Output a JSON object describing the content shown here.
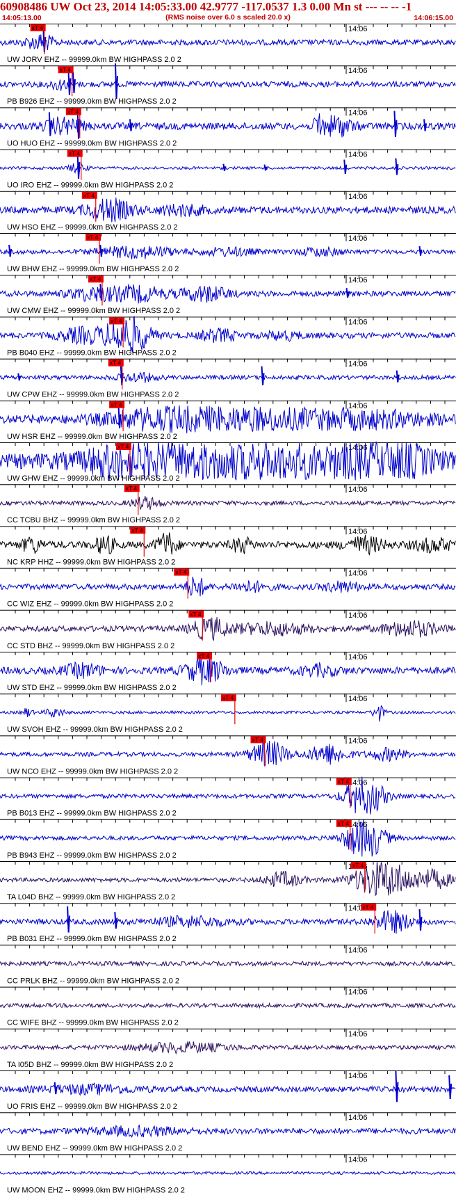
{
  "header": {
    "title": "60908486 UW Oct 23, 2014 14:05:33.00   42.9777 -117.0537  1.3 0.00 Mn st --- -- --  -1",
    "subtitle": "(RMS noise over 6.0 s scaled 20.0 x)",
    "time_start": "14:05:13.00",
    "time_end": "14:06:15.00"
  },
  "chart_data": {
    "type": "line",
    "title": "60908486 UW Oct 23, 2014 14:05:33.00   42.9777 -117.0537  1.3 0.00 Mn st --- -- --  -1",
    "subtitle": "(RMS noise over 6.0 s scaled 20.0 x)",
    "x_range": [
      "14:05:13.00",
      "14:06:15.00"
    ],
    "x_tick_label": "14:06",
    "pick_label": "xT 4",
    "grid": false,
    "traces": [
      {
        "label": "UW JORV EHZ -- 99999.0km BW  HIGHPASS  2.0  2",
        "color": "#0000cc",
        "amp": 4,
        "pick": 0.097,
        "bursts": [
          [
            0.08,
            0.03,
            7
          ],
          [
            0.1,
            0.02,
            5
          ]
        ],
        "spikes": [
          [
            0.095,
            20
          ]
        ]
      },
      {
        "label": "PB B926 EHZ -- 99999.0km BW  HIGHPASS  2.0  2",
        "color": "#0000cc",
        "amp": 4,
        "pick": 0.158,
        "bursts": [
          [
            0.13,
            0.02,
            6
          ]
        ],
        "spikes": [
          [
            0.15,
            22
          ],
          [
            0.253,
            30
          ],
          [
            0.16,
            18
          ]
        ]
      },
      {
        "label": "UO HUO EHZ -- 99999.0km BW  HIGHPASS  2.0  2",
        "color": "#0000cc",
        "amp": 5,
        "pick": 0.175,
        "bursts": [
          [
            0.14,
            0.04,
            10
          ],
          [
            0.74,
            0.03,
            14
          ],
          [
            0.7,
            0.01,
            18
          ]
        ],
        "spikes": [
          [
            0.108,
            20
          ],
          [
            0.17,
            26
          ],
          [
            0.865,
            22
          ],
          [
            0.93,
            10
          ],
          [
            0.285,
            10
          ]
        ]
      },
      {
        "label": "UO IRO EHZ -- 99999.0km BW  HIGHPASS  2.0  2",
        "color": "#0000cc",
        "amp": 2,
        "pick": 0.178,
        "bursts": [
          [
            0.17,
            0.02,
            6
          ]
        ],
        "spikes": [
          [
            0.17,
            22
          ],
          [
            0.755,
            12
          ],
          [
            0.868,
            14
          ],
          [
            0.49,
            6
          ],
          [
            0.58,
            5
          ]
        ]
      },
      {
        "label": "UW HSO EHZ -- 99999.0km BW  HIGHPASS  2.0  2",
        "color": "#0000cc",
        "amp": 5,
        "pick": 0.21,
        "bursts": [
          [
            0.24,
            0.05,
            14
          ],
          [
            0.4,
            0.05,
            6
          ]
        ],
        "spikes": []
      },
      {
        "label": "UW BHW EHZ -- 99999.0km BW  HIGHPASS  2.0  2",
        "color": "#0000cc",
        "amp": 3,
        "pick": 0.218,
        "bursts": [
          [
            0.3,
            0.08,
            8
          ],
          [
            0.5,
            0.06,
            5
          ],
          [
            0.7,
            0.05,
            5
          ]
        ],
        "spikes": [
          [
            0.02,
            10
          ],
          [
            0.92,
            8
          ],
          [
            0.22,
            10
          ]
        ]
      },
      {
        "label": "UW CMW EHZ -- 99999.0km BW  HIGHPASS  2.0  2",
        "color": "#0000cc",
        "amp": 4,
        "pick": 0.224,
        "bursts": [
          [
            0.3,
            0.06,
            10
          ],
          [
            0.45,
            0.05,
            10
          ],
          [
            0.2,
            0.05,
            8
          ]
        ],
        "spikes": [
          [
            0.22,
            14
          ],
          [
            0.76,
            8
          ]
        ]
      },
      {
        "label": "PB B040 EHZ -- 99999.0km BW  HIGHPASS  2.0  2",
        "color": "#0000cc",
        "amp": 4,
        "pick": 0.27,
        "bursts": [
          [
            0.28,
            0.045,
            30
          ],
          [
            0.18,
            0.05,
            10
          ],
          [
            0.48,
            0.04,
            8
          ],
          [
            0.62,
            0.04,
            5
          ]
        ],
        "spikes": []
      },
      {
        "label": "UW CPW EHZ -- 99999.0km BW  HIGHPASS  2.0  2",
        "color": "#0000cc",
        "amp": 3,
        "pick": 0.268,
        "bursts": [
          [
            0.3,
            0.04,
            6
          ]
        ],
        "spikes": [
          [
            0.265,
            16
          ],
          [
            0.574,
            16
          ],
          [
            0.87,
            10
          ],
          [
            0.04,
            6
          ]
        ]
      },
      {
        "label": "UW HSR EHZ -- 99999.0km BW  HIGHPASS  2.0  2",
        "color": "#0000cc",
        "amp": 6,
        "pick": 0.27,
        "bursts": [
          [
            0.35,
            0.12,
            12
          ],
          [
            0.55,
            0.15,
            12
          ],
          [
            0.8,
            0.15,
            10
          ]
        ],
        "spikes": [
          [
            0.26,
            18
          ]
        ]
      },
      {
        "label": "UW GHW EHZ -- 99999.0km BW  HIGHPASS  2.0  2",
        "color": "#0000cc",
        "amp": 10,
        "pick": 0.285,
        "bursts": [
          [
            0.5,
            0.25,
            26
          ],
          [
            0.85,
            0.1,
            22
          ],
          [
            0.25,
            0.05,
            12
          ]
        ],
        "spikes": []
      },
      {
        "label": "CC TCBU BHZ -- 99999.0km BW  HIGHPASS  2.0  2",
        "color": "#2a1060",
        "amp": 3,
        "pick": 0.303,
        "bursts": [
          [
            0.32,
            0.03,
            8
          ]
        ],
        "spikes": []
      },
      {
        "label": "NC KRP HHZ -- 99999.0km BW  HIGHPASS  2.0  2",
        "color": "#000000",
        "amp": 5,
        "pick": 0.316,
        "bursts": [
          [
            0.07,
            0.02,
            10
          ],
          [
            0.23,
            0.02,
            12
          ],
          [
            0.365,
            0.02,
            16
          ],
          [
            0.53,
            0.02,
            10
          ],
          [
            0.8,
            0.04,
            10
          ],
          [
            0.95,
            0.04,
            8
          ]
        ],
        "spikes": []
      },
      {
        "label": "CC WIZ EHZ -- 99999.0km BW  HIGHPASS  2.0  2",
        "color": "#0000cc",
        "amp": 4,
        "pick": 0.412,
        "bursts": [
          [
            0.43,
            0.02,
            14
          ],
          [
            0.55,
            0.04,
            6
          ],
          [
            0.75,
            0.04,
            6
          ]
        ],
        "spikes": []
      },
      {
        "label": "CC STD BHZ -- 99999.0km BW  HIGHPASS  2.0  2",
        "color": "#2a1060",
        "amp": 4,
        "pick": 0.444,
        "bursts": [
          [
            0.46,
            0.04,
            14
          ],
          [
            0.6,
            0.08,
            8
          ],
          [
            0.9,
            0.06,
            10
          ]
        ],
        "spikes": []
      },
      {
        "label": "UW STD EHZ -- 99999.0km BW  HIGHPASS  2.0  2",
        "color": "#0000cc",
        "amp": 5,
        "pick": 0.462,
        "bursts": [
          [
            0.45,
            0.04,
            18
          ],
          [
            0.18,
            0.04,
            8
          ],
          [
            0.7,
            0.04,
            6
          ]
        ],
        "spikes": []
      },
      {
        "label": "UW SVOH EHZ -- 99999.0km BW  HIGHPASS  2.0  2",
        "color": "#0000cc",
        "amp": 2,
        "pick": 0.515,
        "bursts": [
          [
            0.83,
            0.012,
            12
          ],
          [
            0.12,
            0.02,
            6
          ],
          [
            0.06,
            0.01,
            6
          ]
        ],
        "spikes": []
      },
      {
        "label": "UW NCO EHZ -- 99999.0km BW  HIGHPASS  2.0  2",
        "color": "#0000cc",
        "amp": 3,
        "pick": 0.58,
        "bursts": [
          [
            0.59,
            0.04,
            18
          ],
          [
            0.72,
            0.04,
            14
          ],
          [
            0.85,
            0.04,
            8
          ]
        ],
        "spikes": []
      },
      {
        "label": "PB B013 EHZ -- 99999.0km BW  HIGHPASS  2.0  2",
        "color": "#0000cc",
        "amp": 3,
        "pick": 0.768,
        "bursts": [
          [
            0.8,
            0.04,
            30
          ]
        ],
        "spikes": []
      },
      {
        "label": "PB B943 EHZ -- 99999.0km BW  HIGHPASS  2.0  2",
        "color": "#0000cc",
        "amp": 3,
        "pick": 0.768,
        "bursts": [
          [
            0.8,
            0.04,
            32
          ]
        ],
        "spikes": []
      },
      {
        "label": "TA L04D BHZ -- 99999.0km BW  HIGHPASS  2.0  2",
        "color": "#2a1060",
        "amp": 3,
        "pick": 0.8,
        "bursts": [
          [
            0.62,
            0.04,
            10
          ],
          [
            0.84,
            0.06,
            28
          ],
          [
            0.95,
            0.04,
            12
          ]
        ],
        "spikes": []
      },
      {
        "label": "PB B031 EHZ -- 99999.0km BW  HIGHPASS  2.0  2",
        "color": "#0000cc",
        "amp": 4,
        "pick": 0.822,
        "bursts": [
          [
            0.42,
            0.08,
            6
          ],
          [
            0.86,
            0.04,
            14
          ]
        ],
        "spikes": [
          [
            0.148,
            22
          ],
          [
            0.252,
            14
          ],
          [
            0.92,
            18
          ]
        ]
      },
      {
        "label": "CC PRLK BHZ -- 99999.0km BW  HIGHPASS  2.0  2",
        "color": "#2a1060",
        "amp": 3,
        "pick": null,
        "bursts": [],
        "spikes": []
      },
      {
        "label": "CC WIFE BHZ -- 99999.0km BW  HIGHPASS  2.0  2",
        "color": "#2a1060",
        "amp": 3,
        "pick": null,
        "bursts": [],
        "spikes": []
      },
      {
        "label": "TA I05D BHZ -- 99999.0km BW  HIGHPASS  2.0  2",
        "color": "#2a1060",
        "amp": 3,
        "pick": null,
        "bursts": [
          [
            0.4,
            0.1,
            6
          ]
        ],
        "spikes": []
      },
      {
        "label": "UO FRIS EHZ -- 99999.0km BW  HIGHPASS  2.0  2",
        "color": "#0000cc",
        "amp": 4,
        "pick": null,
        "bursts": [
          [
            0.2,
            0.1,
            5
          ]
        ],
        "spikes": [
          [
            0.868,
            26
          ],
          [
            0.985,
            20
          ],
          [
            0.12,
            10
          ]
        ]
      },
      {
        "label": "UW BEND EHZ -- 99999.0km BW  HIGHPASS  2.0  2",
        "color": "#0000cc",
        "amp": 4,
        "pick": null,
        "bursts": [
          [
            0.3,
            0.1,
            5
          ]
        ],
        "spikes": []
      },
      {
        "label": "UW MOON EHZ -- 99999.0km BW  HIGHPASS  2.0  2",
        "color": "#0000cc",
        "amp": 2,
        "pick": null,
        "bursts": [],
        "spikes": []
      }
    ]
  }
}
